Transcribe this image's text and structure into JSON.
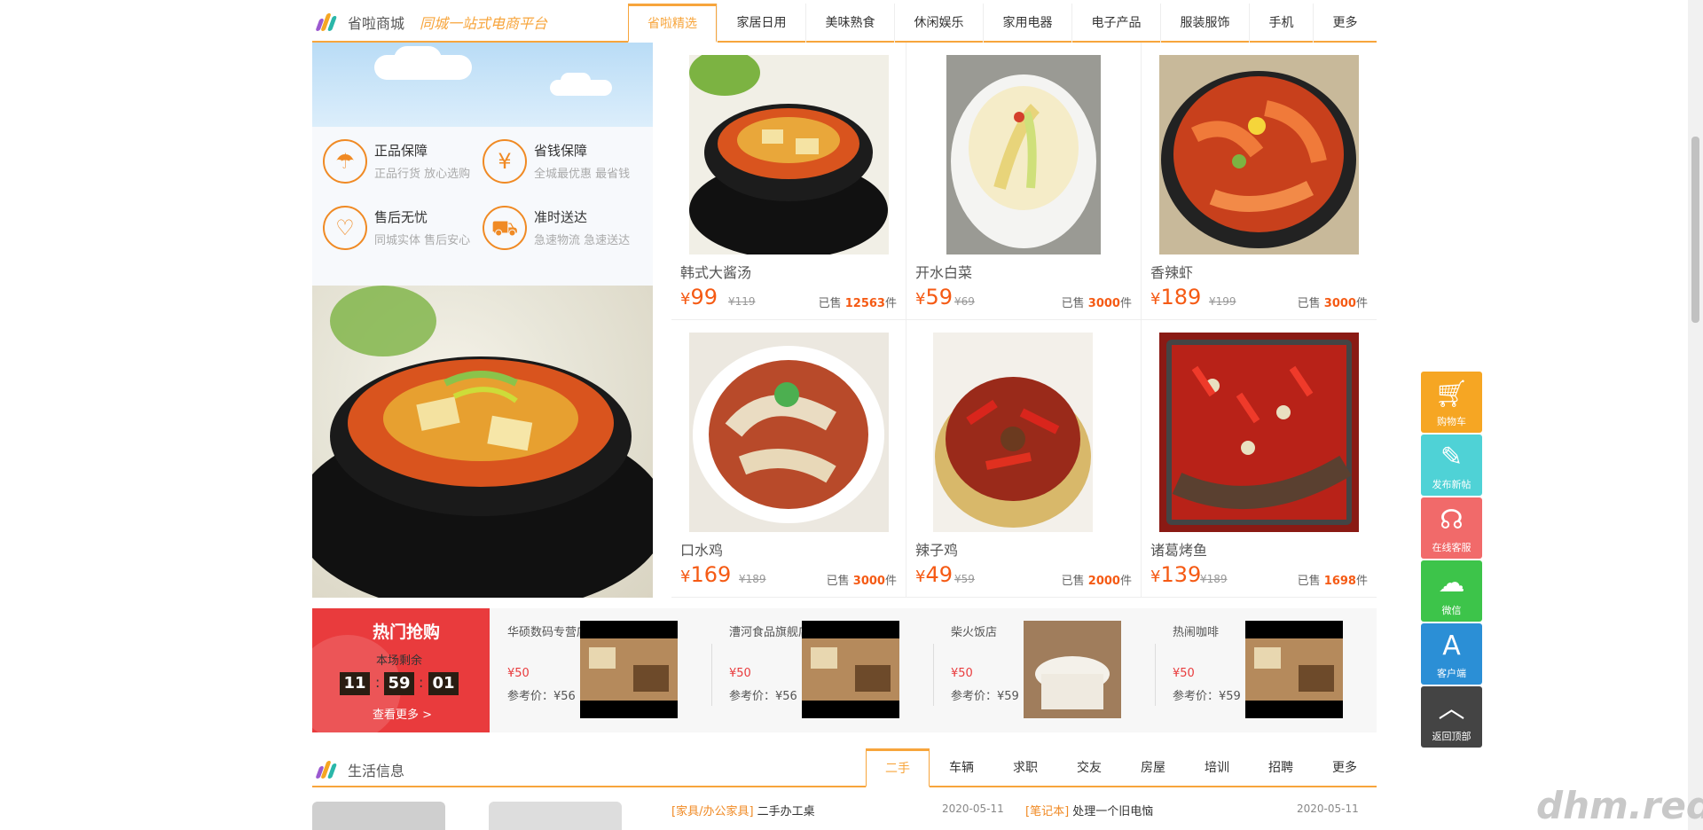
{
  "header": {
    "brand": "省啦商城",
    "slogan": "同城一站式电商平台",
    "tabs": [
      "省啦精选",
      "家居日用",
      "美味熟食",
      "休闲娱乐",
      "家用电器",
      "电子产品",
      "服装服饰",
      "手机",
      "更多"
    ]
  },
  "guarantees": [
    {
      "title": "正品保障",
      "sub": "正品行货 放心选购",
      "icon": "umbrella-icon"
    },
    {
      "title": "省钱保障",
      "sub": "全城最优惠  最省钱",
      "icon": "money-bag-icon"
    },
    {
      "title": "售后无忧",
      "sub": "同城实体 售后安心",
      "icon": "heart-icon"
    },
    {
      "title": "准时送达",
      "sub": "急速物流 急速送达",
      "icon": "truck-icon"
    }
  ],
  "products": [
    {
      "name": "韩式大酱汤",
      "currency": "¥",
      "price": "99",
      "old": "¥119",
      "sold_prefix": "已售",
      "sold": "12563",
      "sold_unit": "件"
    },
    {
      "name": "开水白菜",
      "currency": "¥",
      "price": "59",
      "old": "¥69",
      "sold_prefix": "已售",
      "sold": "3000",
      "sold_unit": "件"
    },
    {
      "name": "香辣虾",
      "currency": "¥",
      "price": "189",
      "old": "¥199",
      "sold_prefix": "已售",
      "sold": "3000",
      "sold_unit": "件"
    },
    {
      "name": "口水鸡",
      "currency": "¥",
      "price": "169",
      "old": "¥189",
      "sold_prefix": "已售",
      "sold": "3000",
      "sold_unit": "件"
    },
    {
      "name": "辣子鸡",
      "currency": "¥",
      "price": "49",
      "old": "¥59",
      "sold_prefix": "已售",
      "sold": "2000",
      "sold_unit": "件"
    },
    {
      "name": "诸葛烤鱼",
      "currency": "¥",
      "price": "139",
      "old": "¥189",
      "sold_prefix": "已售",
      "sold": "1698",
      "sold_unit": "件"
    }
  ],
  "hot": {
    "title": "热门抢购",
    "sub": "本场剩余",
    "countdown": [
      "11",
      "59",
      "01"
    ],
    "more": "查看更多 >",
    "deals": [
      {
        "shop": "华硕数码专营店",
        "price": "¥50",
        "ref": "参考价：¥56"
      },
      {
        "shop": "漕河食品旗舰店",
        "price": "¥50",
        "ref": "参考价：¥56"
      },
      {
        "shop": "柴火饭店",
        "price": "¥50",
        "ref": "参考价：¥59"
      },
      {
        "shop": "热闹咖啡",
        "price": "¥50",
        "ref": "参考价：¥59"
      }
    ]
  },
  "life": {
    "title": "生活信息",
    "tabs": [
      "二手",
      "车辆",
      "求职",
      "交友",
      "房屋",
      "培训",
      "招聘",
      "更多"
    ],
    "news": [
      {
        "cat": "[家具/办公家具]",
        "text": "二手办工桌",
        "date": "2020-05-11"
      },
      {
        "cat": "[笔记本]",
        "text": "处理一个旧电恼",
        "date": "2020-05-11"
      }
    ]
  },
  "side": [
    {
      "label": "购物车",
      "icon": "cart-icon",
      "color": "#f6a623"
    },
    {
      "label": "发布新帖",
      "icon": "edit-icon",
      "color": "#4fd2d6"
    },
    {
      "label": "在线客服",
      "icon": "headset-icon",
      "color": "#f16a6a"
    },
    {
      "label": "微信",
      "icon": "wechat-icon",
      "color": "#3dc44a"
    },
    {
      "label": "客户端",
      "icon": "app-store-icon",
      "color": "#2b8fd6"
    },
    {
      "label": "返回顶部",
      "icon": "chevron-up-icon",
      "color": "#444444"
    }
  ],
  "watermark": "dhm.red"
}
